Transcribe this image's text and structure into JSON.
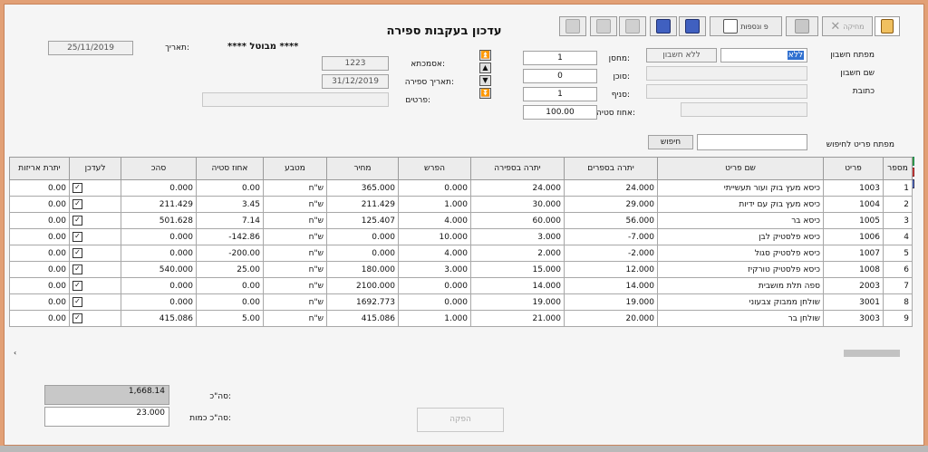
{
  "window": {
    "title": "עדכון בעקבות ספירה"
  },
  "toolbar": {
    "exit_label": "מחיקה",
    "inventory_label": "פ ונספות",
    "exit_icon": "exit-door-icon",
    "accent": "#e07030"
  },
  "header": {
    "date_label": "תאריך:",
    "date_value": "25/11/2019",
    "status_text": "**** מבוטל ****",
    "asmachta_label": "אסמכתא:",
    "asmachta_value": "1223",
    "count_date_label": "תאריך ספירה:",
    "count_date_value": "31/12/2019",
    "details_label": "פרטים:",
    "details_value": "",
    "warehouse_label": "מחסן:",
    "warehouse_value": "1",
    "agent_label": "סוכן:",
    "agent_value": "0",
    "branch_label": "סניף:",
    "branch_value": "1",
    "percent_label": "אחוז סטיה:",
    "percent_value": "100.00",
    "account_key_label": "מפתח חשבון",
    "account_key_value": "ללא",
    "no_account_text": "ללא חשבון",
    "account_name_label": "שם חשבון",
    "address_label": "כתובת",
    "search_label": "מפתח פריט לחיפוש",
    "search_button": "חיפוש",
    "search_value": ""
  },
  "table": {
    "headers": {
      "num": "מספר",
      "item_key": "פריט",
      "item_name": "שם פריט",
      "count_balance": "יתרה בספרים",
      "count_qty": "יתרה בספירה",
      "diff": "הפרש",
      "price": "מחיר",
      "currency": "מטבע",
      "percent": "אחוז סטיה",
      "total": "סהכ",
      "update": "לעדכן",
      "unit_balance": "יתרת אריזות"
    },
    "rows": [
      {
        "num": "1",
        "key": "1003",
        "name": "כיסא מעץ בוק ועור תעשייתי",
        "balance": "24.000",
        "counted": "24.000",
        "diff": "0.000",
        "price": "365.000",
        "currency": "ש\"ח",
        "percent": "0.00",
        "total": "0.000",
        "checked": "✓",
        "units": "0.00"
      },
      {
        "num": "2",
        "key": "1004",
        "name": "כיסא מעץ בוק עם ידיות",
        "balance": "29.000",
        "counted": "30.000",
        "diff": "1.000",
        "price": "211.429",
        "currency": "ש\"ח",
        "percent": "3.45",
        "total": "211.429",
        "checked": "✓",
        "units": "0.00"
      },
      {
        "num": "3",
        "key": "1005",
        "name": "כיסא בר",
        "balance": "56.000",
        "counted": "60.000",
        "diff": "4.000",
        "price": "125.407",
        "currency": "ש\"ח",
        "percent": "7.14",
        "total": "501.628",
        "checked": "✓",
        "units": "0.00"
      },
      {
        "num": "4",
        "key": "1006",
        "name": "כיסא פלסטיק לבן",
        "balance": "-7.000",
        "counted": "3.000",
        "diff": "10.000",
        "price": "0.000",
        "currency": "ש\"ח",
        "percent": "-142.86",
        "total": "0.000",
        "checked": "✓",
        "units": "0.00"
      },
      {
        "num": "5",
        "key": "1007",
        "name": "כיסא פלסטיק סגול",
        "balance": "-2.000",
        "counted": "2.000",
        "diff": "4.000",
        "price": "0.000",
        "currency": "ש\"ח",
        "percent": "-200.00",
        "total": "0.000",
        "checked": "✓",
        "units": "0.00"
      },
      {
        "num": "6",
        "key": "1008",
        "name": "כיסא פלסטיק טורקיז",
        "balance": "12.000",
        "counted": "15.000",
        "diff": "3.000",
        "price": "180.000",
        "currency": "ש\"ח",
        "percent": "25.00",
        "total": "540.000",
        "checked": "✓",
        "units": "0.00"
      },
      {
        "num": "7",
        "key": "2003",
        "name": "ספה תלת מושבית",
        "balance": "14.000",
        "counted": "14.000",
        "diff": "0.000",
        "price": "2100.000",
        "currency": "ש\"ח",
        "percent": "0.00",
        "total": "0.000",
        "checked": "✓",
        "units": "0.00"
      },
      {
        "num": "8",
        "key": "3001",
        "name": "שולחן ממבוק צבעוני",
        "balance": "19.000",
        "counted": "19.000",
        "diff": "0.000",
        "price": "1692.773",
        "currency": "ש\"ח",
        "percent": "0.00",
        "total": "0.000",
        "checked": "✓",
        "units": "0.00"
      },
      {
        "num": "9",
        "key": "3003",
        "name": "שולחן בר",
        "balance": "20.000",
        "counted": "21.000",
        "diff": "1.000",
        "price": "415.086",
        "currency": "ש\"ח",
        "percent": "5.00",
        "total": "415.086",
        "checked": "✓",
        "units": "0.00"
      }
    ]
  },
  "totals": {
    "total_label": "סה\"כ:",
    "total_value": "1,668.14",
    "qty_label": "סה\"כ כמות:",
    "qty_value": "23.000"
  },
  "footer": {
    "produce_button": "הפקה"
  }
}
